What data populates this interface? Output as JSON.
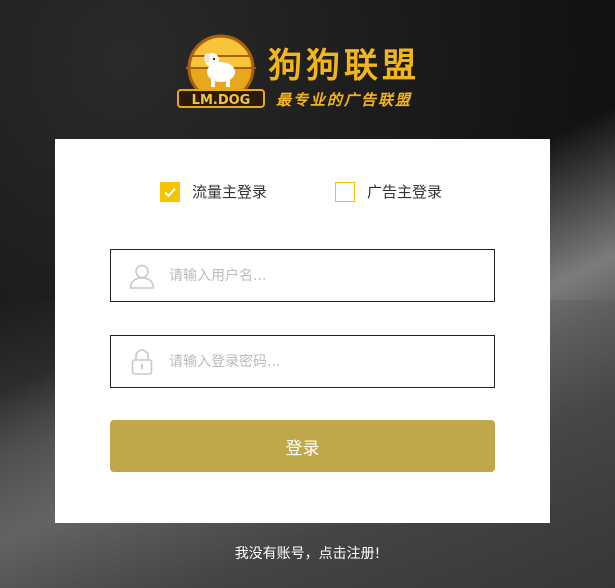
{
  "logo": {
    "badge_text": "LM.DOG",
    "title": "狗狗联盟",
    "slogan": "最专业的广告联盟"
  },
  "login_type": {
    "options": [
      {
        "label": "流量主登录",
        "checked": true
      },
      {
        "label": "广告主登录",
        "checked": false
      }
    ]
  },
  "form": {
    "username_placeholder": "请输入用户名...",
    "username_value": "",
    "password_placeholder": "请输入登录密码...",
    "password_value": "",
    "submit_label": "登录"
  },
  "footer": {
    "register_text": "我没有账号，点击注册!"
  },
  "colors": {
    "accent_yellow": "#f5c400",
    "button_gold": "#c0a84a",
    "logo_orange": "#f3b51a"
  },
  "icons": {
    "username": "user-icon",
    "password": "lock-icon",
    "checked": "checkmark-icon",
    "logo": "dog-logo-icon"
  }
}
